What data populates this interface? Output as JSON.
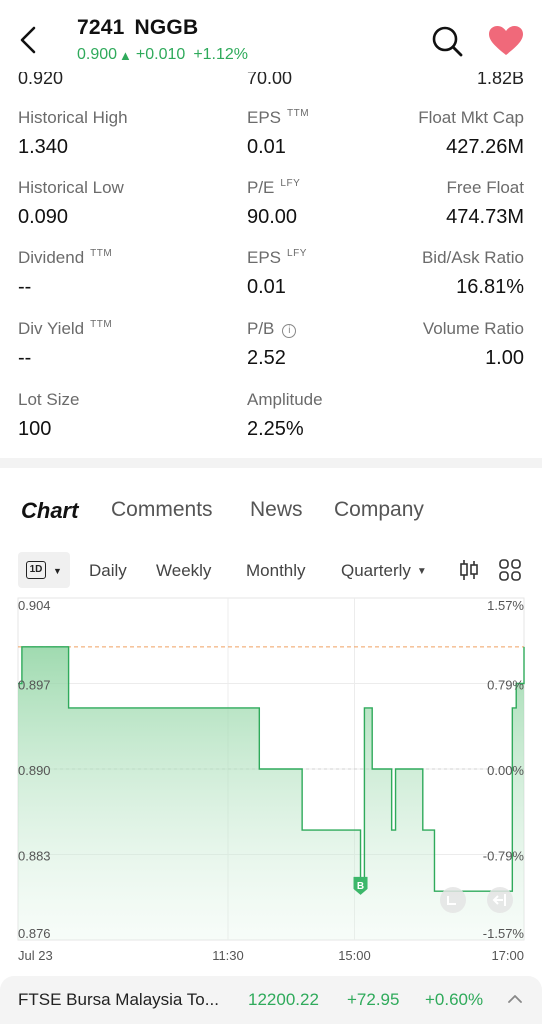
{
  "header": {
    "code": "7241",
    "name": "NGGB",
    "price": "0.900",
    "change": "+0.010",
    "change_pct": "+1.12%",
    "up_color": "#2faa5b",
    "fav_color": "#f0697a"
  },
  "cut_row": {
    "c1": "0.920",
    "c2": "70.00",
    "c3": "1.82B"
  },
  "stats": {
    "historical_high": {
      "label": "Historical High",
      "value": "1.340"
    },
    "eps_ttm": {
      "label": "EPS",
      "sup": "TTM",
      "value": "0.01"
    },
    "float_mkt_cap": {
      "label": "Float Mkt Cap",
      "value": "427.26M"
    },
    "historical_low": {
      "label": "Historical Low",
      "value": "0.090"
    },
    "pe_lfy": {
      "label": "P/E",
      "sup": "LFY",
      "value": "90.00"
    },
    "free_float": {
      "label": "Free Float",
      "value": "474.73M"
    },
    "dividend_ttm": {
      "label": "Dividend",
      "sup": "TTM",
      "value": "--"
    },
    "eps_lfy": {
      "label": "EPS",
      "sup": "LFY",
      "value": "0.01"
    },
    "bid_ask_ratio": {
      "label": "Bid/Ask Ratio",
      "value": "16.81%"
    },
    "div_yield_ttm": {
      "label": "Div Yield",
      "sup": "TTM",
      "value": "--"
    },
    "pb": {
      "label": "P/B",
      "info": "i",
      "value": "2.52"
    },
    "volume_ratio": {
      "label": "Volume Ratio",
      "value": "1.00"
    },
    "lot_size": {
      "label": "Lot Size",
      "value": "100"
    },
    "amplitude": {
      "label": "Amplitude",
      "value": "2.25%"
    }
  },
  "tabs": [
    "Chart",
    "Comments",
    "News",
    "Company"
  ],
  "periods": {
    "current": "1D",
    "items": [
      "Daily",
      "Weekly",
      "Monthly",
      "Quarterly"
    ]
  },
  "chart_data": {
    "type": "area",
    "y_left_ticks": [
      "0.904",
      "0.897",
      "0.890",
      "0.883",
      "0.876"
    ],
    "y_right_ticks": [
      "1.57%",
      "0.79%",
      "0.00%",
      "-0.79%",
      "-1.57%"
    ],
    "x_ticks": [
      "Jul 23",
      "11:30",
      "15:00",
      "17:00"
    ],
    "ylim": [
      0.876,
      0.904
    ],
    "prev_close": 0.89,
    "reference_line": 0.9,
    "series": [
      {
        "x": [
          0,
          1,
          12,
          13,
          60,
          62,
          64,
          73,
          75,
          87,
          88,
          89,
          91,
          92,
          95,
          96,
          97,
          98,
          100,
          104,
          105,
          106,
          107,
          112,
          113,
          126,
          127,
          128,
          130
        ],
        "values": [
          0.897,
          0.9,
          0.9,
          0.895,
          0.895,
          0.89,
          0.89,
          0.885,
          0.885,
          0.885,
          0.881,
          0.895,
          0.89,
          0.89,
          0.89,
          0.885,
          0.89,
          0.89,
          0.89,
          0.885,
          0.885,
          0.885,
          0.88,
          0.88,
          0.88,
          0.88,
          0.895,
          0.897,
          0.9
        ]
      }
    ],
    "line_color": "#2faa5b",
    "marker": {
      "label": "B"
    },
    "grid": true
  },
  "ticker": {
    "name": "FTSE Bursa Malaysia To...",
    "price": "12200.22",
    "change": "+72.95",
    "change_pct": "+0.60%"
  }
}
